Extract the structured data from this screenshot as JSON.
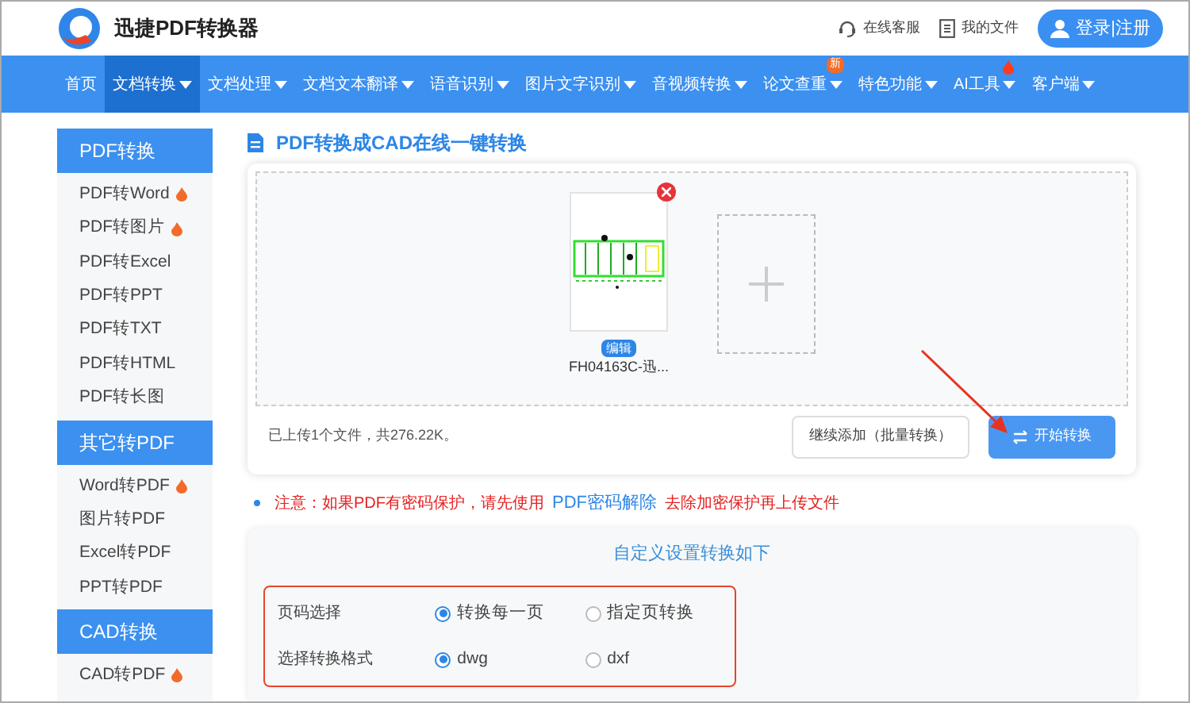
{
  "brand": {
    "name": "迅捷PDF转换器"
  },
  "header_links": [
    {
      "kind": "headset",
      "label": "在线客服"
    },
    {
      "kind": "file",
      "label": "我的文件"
    }
  ],
  "login_button": "登录|注册",
  "nav": [
    {
      "label": "首页",
      "selected": false,
      "dropdown": false
    },
    {
      "label": "文档转换",
      "selected": true,
      "dropdown": true
    },
    {
      "label": "文档处理",
      "selected": false,
      "dropdown": true
    },
    {
      "label": "文档文本翻译",
      "selected": false,
      "dropdown": true
    },
    {
      "label": "语音识别",
      "selected": false,
      "dropdown": true
    },
    {
      "label": "图片文字识别",
      "selected": false,
      "dropdown": true
    },
    {
      "label": "音视频转换",
      "selected": false,
      "dropdown": true
    },
    {
      "label": "论文查重",
      "selected": false,
      "dropdown": true,
      "badge": "新"
    },
    {
      "label": "特色功能",
      "selected": false,
      "dropdown": true
    },
    {
      "label": "AI工具",
      "selected": false,
      "dropdown": true,
      "hot": true
    },
    {
      "label": "客户端",
      "selected": false,
      "dropdown": true
    }
  ],
  "sidebar": [
    {
      "title": "PDF转换",
      "items": [
        {
          "label": "PDF转Word",
          "hot": true
        },
        {
          "label": "PDF转图片",
          "hot": true
        },
        {
          "label": "PDF转Excel",
          "hot": false
        },
        {
          "label": "PDF转PPT",
          "hot": false
        },
        {
          "label": "PDF转TXT",
          "hot": false
        },
        {
          "label": "PDF转HTML",
          "hot": false
        },
        {
          "label": "PDF转长图",
          "hot": false
        }
      ]
    },
    {
      "title": "其它转PDF",
      "items": [
        {
          "label": "Word转PDF",
          "hot": true
        },
        {
          "label": "图片转PDF",
          "hot": false
        },
        {
          "label": "Excel转PDF",
          "hot": false
        },
        {
          "label": "PPT转PDF",
          "hot": false
        }
      ]
    },
    {
      "title": "CAD转换",
      "items": [
        {
          "label": "CAD转PDF",
          "hot": true
        }
      ]
    }
  ],
  "page_title": "PDF转换成CAD在线一键转换",
  "upload": {
    "files": [
      {
        "name": "FH04163C-迅...",
        "edit_label": "编辑"
      }
    ],
    "summary": "已上传1个文件，共276.22K。",
    "add_button": "继续添加（批量转换）",
    "start_button": "开始转换"
  },
  "notice": {
    "before": "注意：如果PDF有密码保护，请先使用",
    "link": "PDF密码解除",
    "after": "去除加密保护再上传文件"
  },
  "settings": {
    "title": "自定义设置转换如下",
    "rows": [
      {
        "label": "页码选择",
        "options": [
          {
            "label": "转换每一页",
            "selected": true
          },
          {
            "label": "指定页转换",
            "selected": false
          }
        ]
      },
      {
        "label": "选择转换格式",
        "options": [
          {
            "label": "dwg",
            "selected": true
          },
          {
            "label": "dxf",
            "selected": false
          }
        ]
      }
    ]
  }
}
